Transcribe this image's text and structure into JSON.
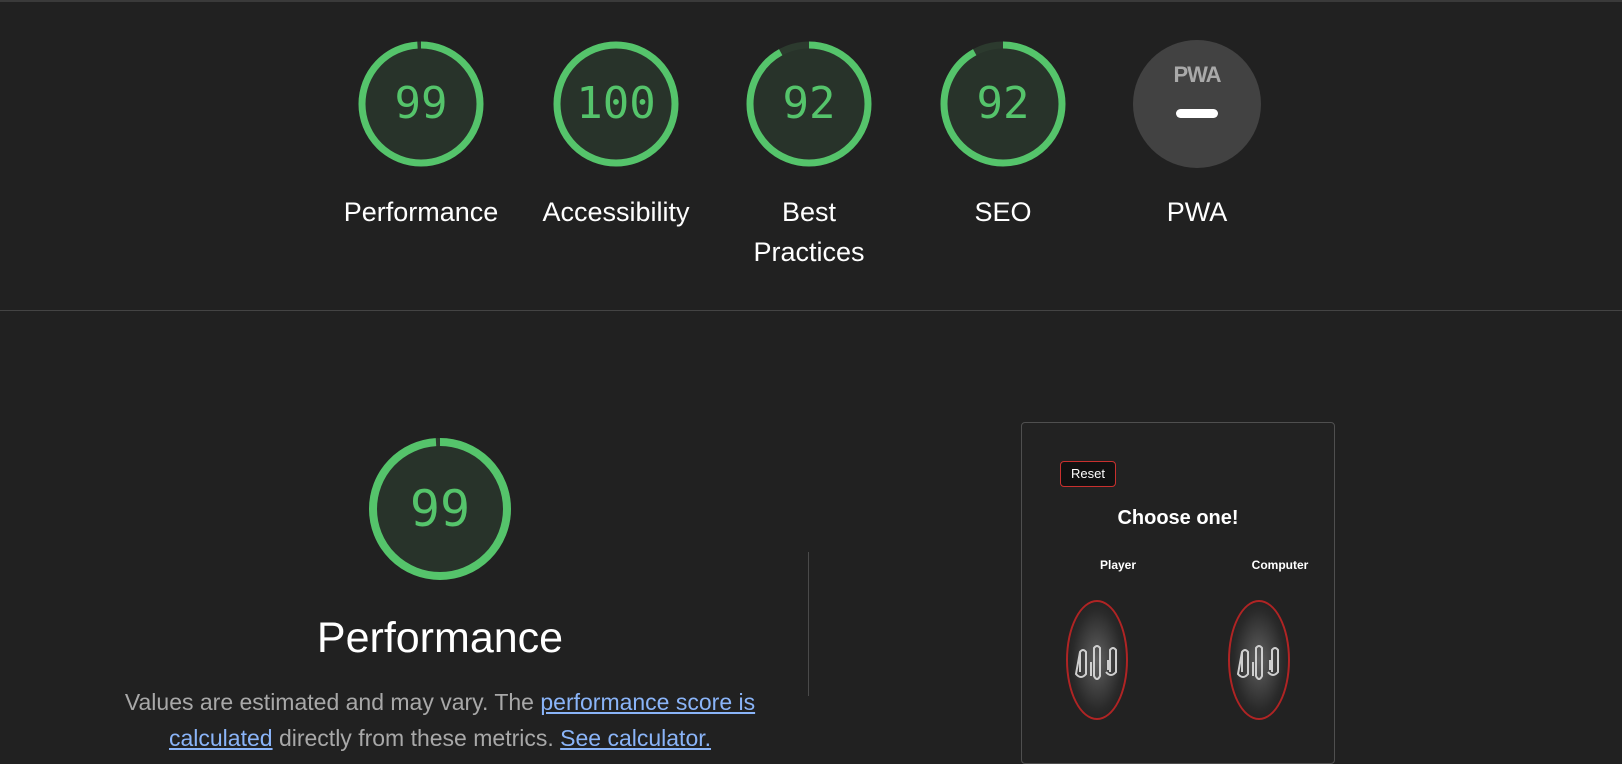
{
  "colors": {
    "background": "#212121",
    "pass": "#55c46b",
    "link": "#8ab4f8",
    "reset_border": "#c8302e"
  },
  "categories": [
    {
      "name": "performance",
      "label": "Performance",
      "score": "99",
      "value": 99
    },
    {
      "name": "accessibility",
      "label": "Accessibility",
      "score": "100",
      "value": 100
    },
    {
      "name": "best-practices",
      "label": "Best Practices",
      "score": "92",
      "value": 92
    },
    {
      "name": "seo",
      "label": "SEO",
      "score": "92",
      "value": 92
    },
    {
      "name": "pwa",
      "label": "PWA",
      "badge_text": "PWA",
      "icon": "pwa-dash-icon"
    }
  ],
  "performance_section": {
    "score": "99",
    "value": 99,
    "title": "Performance",
    "desc_prefix": "Values are estimated and may vary. The ",
    "link1": "performance score is calculated",
    "desc_middle": " directly from these metrics. ",
    "link2": "See calculator."
  },
  "preview": {
    "reset_label": "Reset",
    "heading": "Choose one!",
    "player_label": "Player",
    "computer_label": "Computer",
    "hand_icon": "rock-paper-scissors-hands-icon"
  }
}
